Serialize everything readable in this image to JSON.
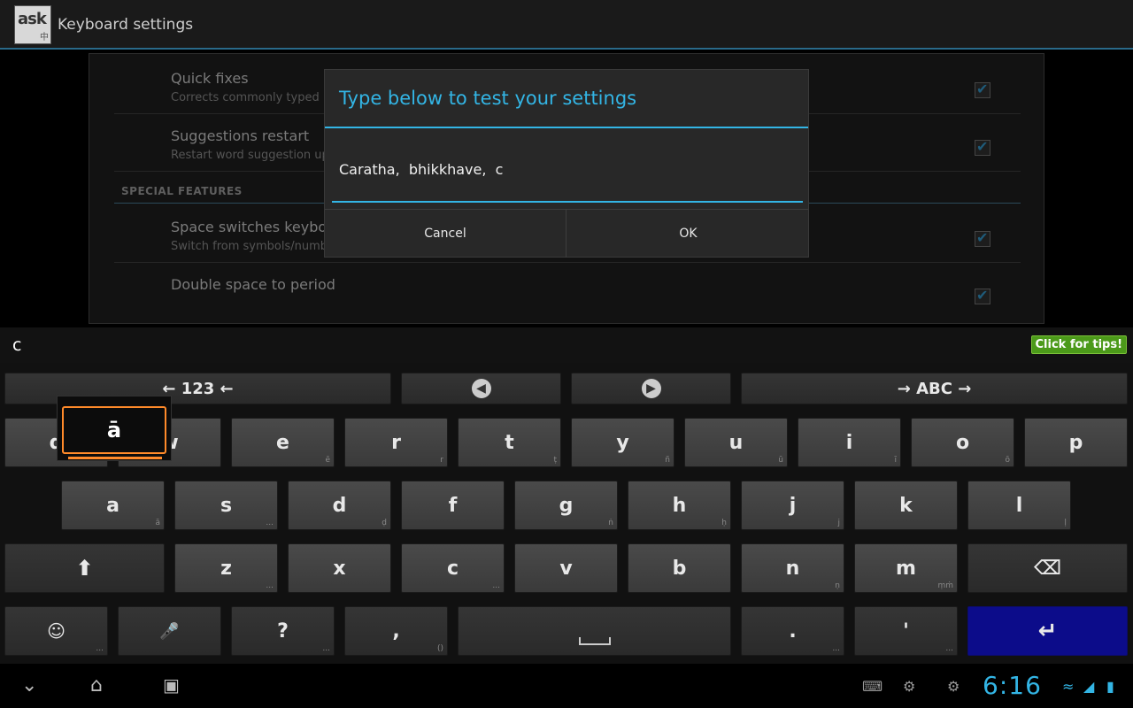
{
  "app": {
    "icon_text": "ask",
    "icon_sub": "中",
    "title": "Keyboard settings"
  },
  "settings": {
    "items": [
      {
        "title": "Quick fixes",
        "summary": "Corrects commonly typed mistakes",
        "checked": true
      },
      {
        "title": "Suggestions restart",
        "summary": "Restart word suggestion upon cursor move",
        "checked": true
      },
      {
        "title": "Space switches keyboard",
        "summary": "Switch from symbols/numbers to alphabet on space",
        "checked": true
      },
      {
        "title": "Double space to period",
        "summary": "",
        "checked": true
      }
    ],
    "section_header": "SPECIAL FEATURES"
  },
  "dialog": {
    "title": "Type below to test your settings",
    "input_value": "Caratha,  bhikkhave,  c",
    "cancel_label": "Cancel",
    "ok_label": "OK"
  },
  "candidate_bar": {
    "candidate": "c",
    "tips_label": "Click for tips!"
  },
  "keyboard": {
    "nav_row": {
      "left": "← 123 ←",
      "right": "→ ABC →"
    },
    "row1": [
      {
        "label": "q",
        "hint": ""
      },
      {
        "label": "w",
        "hint": ""
      },
      {
        "label": "e",
        "hint": "ē"
      },
      {
        "label": "r",
        "hint": "r"
      },
      {
        "label": "t",
        "hint": "ṭ"
      },
      {
        "label": "y",
        "hint": "ñ"
      },
      {
        "label": "u",
        "hint": "ū"
      },
      {
        "label": "i",
        "hint": "ī"
      },
      {
        "label": "o",
        "hint": "ō"
      },
      {
        "label": "p",
        "hint": ""
      }
    ],
    "row2": [
      {
        "label": "a",
        "hint": "ā"
      },
      {
        "label": "s",
        "hint": "..."
      },
      {
        "label": "d",
        "hint": "ḍ"
      },
      {
        "label": "f",
        "hint": ""
      },
      {
        "label": "g",
        "hint": "ṅ"
      },
      {
        "label": "h",
        "hint": "ḥ"
      },
      {
        "label": "j",
        "hint": "j"
      },
      {
        "label": "k",
        "hint": ""
      },
      {
        "label": "l",
        "hint": "ḷ"
      }
    ],
    "row3": [
      {
        "label": "z",
        "hint": "..."
      },
      {
        "label": "x",
        "hint": ""
      },
      {
        "label": "c",
        "hint": "..."
      },
      {
        "label": "v",
        "hint": ""
      },
      {
        "label": "b",
        "hint": ""
      },
      {
        "label": "n",
        "hint": "ṇ"
      },
      {
        "label": "m",
        "hint": "ṃṁ"
      }
    ],
    "row4": {
      "question": "?",
      "comma": ",",
      "comma_hint": "()",
      "period": ".",
      "apostrophe": "'"
    },
    "popup_char": "ā"
  },
  "status": {
    "time": "6:16"
  }
}
